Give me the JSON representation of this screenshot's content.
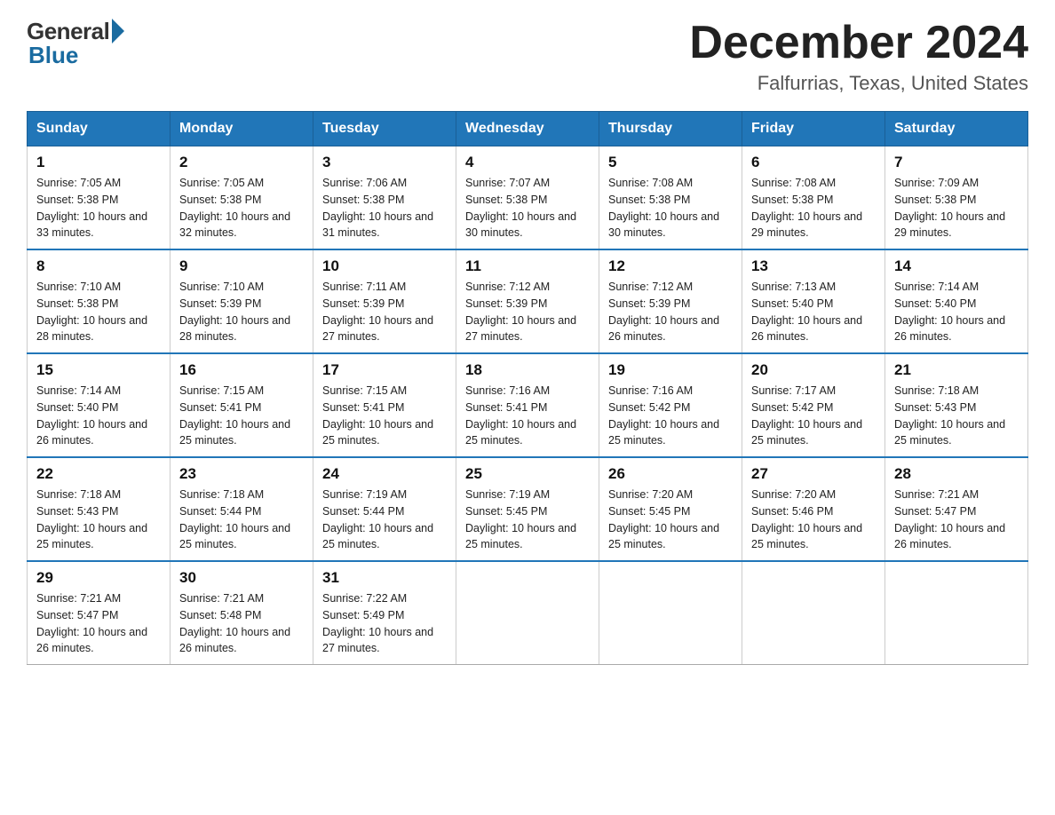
{
  "header": {
    "logo_general": "General",
    "logo_blue": "Blue",
    "month_title": "December 2024",
    "location": "Falfurrias, Texas, United States"
  },
  "days_of_week": [
    "Sunday",
    "Monday",
    "Tuesday",
    "Wednesday",
    "Thursday",
    "Friday",
    "Saturday"
  ],
  "weeks": [
    [
      {
        "day": "1",
        "sunrise": "7:05 AM",
        "sunset": "5:38 PM",
        "daylight": "10 hours and 33 minutes."
      },
      {
        "day": "2",
        "sunrise": "7:05 AM",
        "sunset": "5:38 PM",
        "daylight": "10 hours and 32 minutes."
      },
      {
        "day": "3",
        "sunrise": "7:06 AM",
        "sunset": "5:38 PM",
        "daylight": "10 hours and 31 minutes."
      },
      {
        "day": "4",
        "sunrise": "7:07 AM",
        "sunset": "5:38 PM",
        "daylight": "10 hours and 30 minutes."
      },
      {
        "day": "5",
        "sunrise": "7:08 AM",
        "sunset": "5:38 PM",
        "daylight": "10 hours and 30 minutes."
      },
      {
        "day": "6",
        "sunrise": "7:08 AM",
        "sunset": "5:38 PM",
        "daylight": "10 hours and 29 minutes."
      },
      {
        "day": "7",
        "sunrise": "7:09 AM",
        "sunset": "5:38 PM",
        "daylight": "10 hours and 29 minutes."
      }
    ],
    [
      {
        "day": "8",
        "sunrise": "7:10 AM",
        "sunset": "5:38 PM",
        "daylight": "10 hours and 28 minutes."
      },
      {
        "day": "9",
        "sunrise": "7:10 AM",
        "sunset": "5:39 PM",
        "daylight": "10 hours and 28 minutes."
      },
      {
        "day": "10",
        "sunrise": "7:11 AM",
        "sunset": "5:39 PM",
        "daylight": "10 hours and 27 minutes."
      },
      {
        "day": "11",
        "sunrise": "7:12 AM",
        "sunset": "5:39 PM",
        "daylight": "10 hours and 27 minutes."
      },
      {
        "day": "12",
        "sunrise": "7:12 AM",
        "sunset": "5:39 PM",
        "daylight": "10 hours and 26 minutes."
      },
      {
        "day": "13",
        "sunrise": "7:13 AM",
        "sunset": "5:40 PM",
        "daylight": "10 hours and 26 minutes."
      },
      {
        "day": "14",
        "sunrise": "7:14 AM",
        "sunset": "5:40 PM",
        "daylight": "10 hours and 26 minutes."
      }
    ],
    [
      {
        "day": "15",
        "sunrise": "7:14 AM",
        "sunset": "5:40 PM",
        "daylight": "10 hours and 26 minutes."
      },
      {
        "day": "16",
        "sunrise": "7:15 AM",
        "sunset": "5:41 PM",
        "daylight": "10 hours and 25 minutes."
      },
      {
        "day": "17",
        "sunrise": "7:15 AM",
        "sunset": "5:41 PM",
        "daylight": "10 hours and 25 minutes."
      },
      {
        "day": "18",
        "sunrise": "7:16 AM",
        "sunset": "5:41 PM",
        "daylight": "10 hours and 25 minutes."
      },
      {
        "day": "19",
        "sunrise": "7:16 AM",
        "sunset": "5:42 PM",
        "daylight": "10 hours and 25 minutes."
      },
      {
        "day": "20",
        "sunrise": "7:17 AM",
        "sunset": "5:42 PM",
        "daylight": "10 hours and 25 minutes."
      },
      {
        "day": "21",
        "sunrise": "7:18 AM",
        "sunset": "5:43 PM",
        "daylight": "10 hours and 25 minutes."
      }
    ],
    [
      {
        "day": "22",
        "sunrise": "7:18 AM",
        "sunset": "5:43 PM",
        "daylight": "10 hours and 25 minutes."
      },
      {
        "day": "23",
        "sunrise": "7:18 AM",
        "sunset": "5:44 PM",
        "daylight": "10 hours and 25 minutes."
      },
      {
        "day": "24",
        "sunrise": "7:19 AM",
        "sunset": "5:44 PM",
        "daylight": "10 hours and 25 minutes."
      },
      {
        "day": "25",
        "sunrise": "7:19 AM",
        "sunset": "5:45 PM",
        "daylight": "10 hours and 25 minutes."
      },
      {
        "day": "26",
        "sunrise": "7:20 AM",
        "sunset": "5:45 PM",
        "daylight": "10 hours and 25 minutes."
      },
      {
        "day": "27",
        "sunrise": "7:20 AM",
        "sunset": "5:46 PM",
        "daylight": "10 hours and 25 minutes."
      },
      {
        "day": "28",
        "sunrise": "7:21 AM",
        "sunset": "5:47 PM",
        "daylight": "10 hours and 26 minutes."
      }
    ],
    [
      {
        "day": "29",
        "sunrise": "7:21 AM",
        "sunset": "5:47 PM",
        "daylight": "10 hours and 26 minutes."
      },
      {
        "day": "30",
        "sunrise": "7:21 AM",
        "sunset": "5:48 PM",
        "daylight": "10 hours and 26 minutes."
      },
      {
        "day": "31",
        "sunrise": "7:22 AM",
        "sunset": "5:49 PM",
        "daylight": "10 hours and 27 minutes."
      },
      null,
      null,
      null,
      null
    ]
  ],
  "labels": {
    "sunrise_prefix": "Sunrise: ",
    "sunset_prefix": "Sunset: ",
    "daylight_prefix": "Daylight: "
  }
}
